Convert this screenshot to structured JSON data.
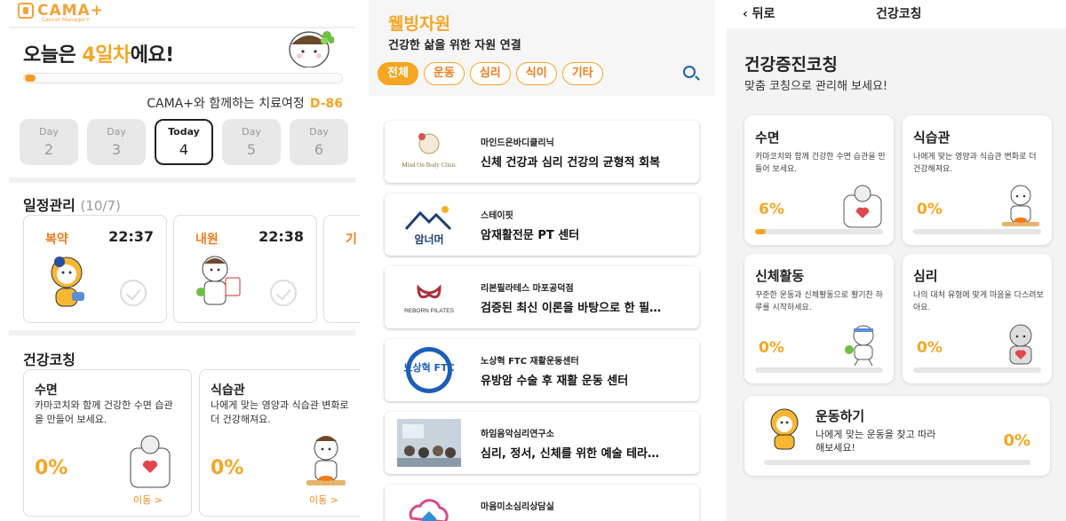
{
  "home": {
    "logo": "CAMA+",
    "logo_sub": "Cancer Manager+",
    "greeting_pre": "오늘은 ",
    "greeting_day": "4일차",
    "greeting_post": "에요!",
    "journey_text": "CAMA+와 함께하는 치료여정",
    "dday": "D-86",
    "days": [
      {
        "label": "Day",
        "num": "2"
      },
      {
        "label": "Day",
        "num": "3"
      },
      {
        "label": "Today",
        "num": "4"
      },
      {
        "label": "Day",
        "num": "5"
      },
      {
        "label": "Day",
        "num": "6"
      }
    ],
    "schedule_title": "일정관리",
    "schedule_date": "(10/7)",
    "schedule": [
      {
        "label": "복약",
        "time": "22:37"
      },
      {
        "label": "내원",
        "time": "22:38"
      },
      {
        "label": "기",
        "time": ""
      }
    ],
    "coaching_title": "건강코칭",
    "coaching": [
      {
        "title": "수면",
        "desc": "카마코치와 함께 건강한 수면 습관을 만들어 보세요.",
        "pct": "0%",
        "move": "이동 >"
      },
      {
        "title": "식습관",
        "desc": "나에게 맞는 영양과 식습관 변화로 더 건강해져요.",
        "pct": "0%",
        "move": "이동 >"
      }
    ]
  },
  "wellbeing": {
    "title": "웰빙자원",
    "subtitle": "건강한 삶을 위한 자원 연결",
    "chips": [
      "전체",
      "운동",
      "심리",
      "식이",
      "기타"
    ],
    "results": [
      {
        "name": "마인드온바디클리닉",
        "desc": "신체 건강과 심리 건강의 균형적 회복",
        "logo_text": "Mind On Body Clinic"
      },
      {
        "name": "스테이핏",
        "desc": "암재활전문 PT 센터",
        "logo_text": "암너머"
      },
      {
        "name": "리본필라테스 마포공덕점",
        "desc": "검증된 최신 이론을 바탕으로 한 필…",
        "logo_text": "REBORN PILATES"
      },
      {
        "name": "노상혁 FTC 재활운동센터",
        "desc": "유방암 수술 후 재활 운동 센터",
        "logo_text": "노상혁 FTC"
      },
      {
        "name": "하임음악심리연구소",
        "desc": "심리, 정서, 신체를 위한 예술 테라…",
        "logo_text": ""
      },
      {
        "name": "마음미소심리상담실",
        "desc": "",
        "logo_text": ""
      }
    ]
  },
  "coaching_page": {
    "back": "뒤로",
    "title": "건강코칭",
    "heading": "건강증진코칭",
    "subheading": "맞춤 코칭으로 관리해 보세요!",
    "cards": [
      {
        "title": "수면",
        "desc": "카마코치와 함께 건강한 수면 습관을 만들어 보세요.",
        "pct": "6%",
        "progress": 0.06
      },
      {
        "title": "식습관",
        "desc": "나에게 맞는 영양과 식습관 변화로 더 건강해져요.",
        "pct": "0%",
        "progress": 0
      },
      {
        "title": "신체활동",
        "desc": "꾸준한 운동과 신체활동으로 활기찬 하루를 시작하세요.",
        "pct": "0%",
        "progress": 0
      },
      {
        "title": "심리",
        "desc": "나의 대처 유형에 맞게 마음을 다스려보아요.",
        "pct": "0%",
        "progress": 0
      }
    ],
    "exercise": {
      "title": "운동하기",
      "desc": "나에게 맞는 운동을 찾고 따라해보세요!",
      "pct": "0%",
      "progress": 0
    }
  },
  "colors": {
    "accent": "#f5a623",
    "accent_dark": "#f07c1a"
  }
}
